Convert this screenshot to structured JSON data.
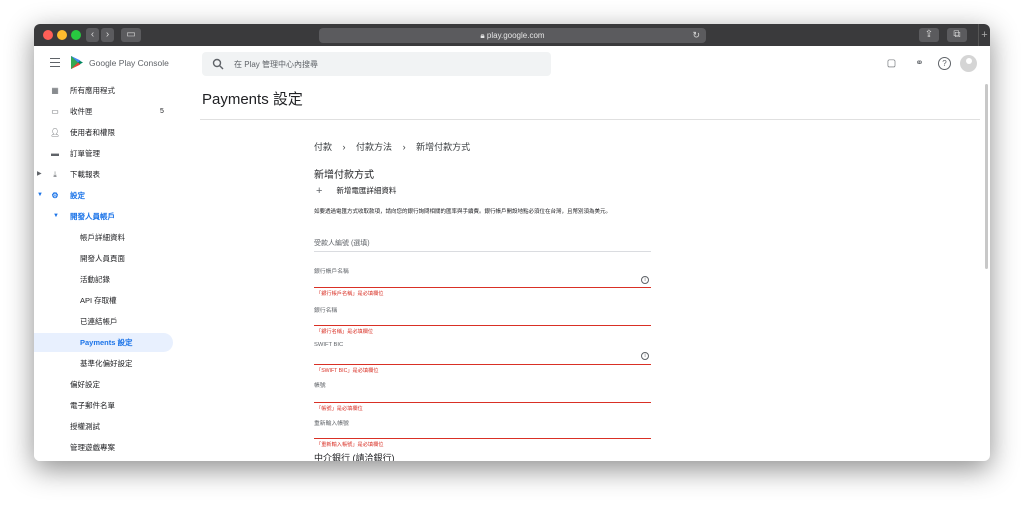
{
  "browser": {
    "url": "play.google.com"
  },
  "app": {
    "title": "Google Play Console",
    "search_placeholder": "在 Play 管理中心內搜尋"
  },
  "sidebar": {
    "items": [
      {
        "label": "所有應用程式",
        "icon": "grid-icon"
      },
      {
        "label": "收件匣",
        "icon": "inbox-icon",
        "badge": "5"
      },
      {
        "label": "使用者和權限",
        "icon": "people-icon"
      },
      {
        "label": "訂單管理",
        "icon": "card-icon"
      },
      {
        "label": "下載報表",
        "icon": "download-icon"
      },
      {
        "label": "設定",
        "icon": "gear-icon"
      },
      {
        "label": "開發人員帳戶"
      },
      {
        "label": "帳戶詳細資料"
      },
      {
        "label": "開發人員頁面"
      },
      {
        "label": "活動記錄"
      },
      {
        "label": "API 存取權"
      },
      {
        "label": "已連結帳戶"
      },
      {
        "label": "Payments 設定"
      },
      {
        "label": "基準化偏好設定"
      },
      {
        "label": "偏好設定"
      },
      {
        "label": "電子郵件名單"
      },
      {
        "label": "授權測試"
      },
      {
        "label": "管理遊戲專案"
      }
    ]
  },
  "page": {
    "title": "Payments 設定",
    "breadcrumb": [
      "付款",
      "付款方法",
      "新增付款方式"
    ],
    "breadcrumb_sep": "›",
    "section_title": "新增付款方式",
    "add_label": "新增電匯詳細資料",
    "note": "如要透過電匯方式收取款項，請向您的銀行詢問相關的匯率與手續費。銀行帳戶開設地點必須位在台灣，且幣別須為美元。",
    "fields": [
      {
        "label": "受款人編號 (選填)",
        "error": ""
      },
      {
        "label": "銀行帳戶名稱",
        "error": "「銀行帳戶名稱」是必填欄位",
        "info": true
      },
      {
        "label": "銀行名稱",
        "error": "「銀行名稱」是必填欄位"
      },
      {
        "label": "SWIFT BIC",
        "error": "「SWIFT BIC」是必填欄位",
        "info": true
      },
      {
        "label": "帳號",
        "error": "「帳號」是必填欄位"
      },
      {
        "label": "重新輸入帳號",
        "error": "「重新輸入帳號」是必填欄位"
      }
    ],
    "bottom_title": "中介銀行 (請洽銀行)"
  },
  "colors": {
    "accent": "#1a73e8",
    "error": "#d93025",
    "titlebar": "#3a3a3c"
  }
}
